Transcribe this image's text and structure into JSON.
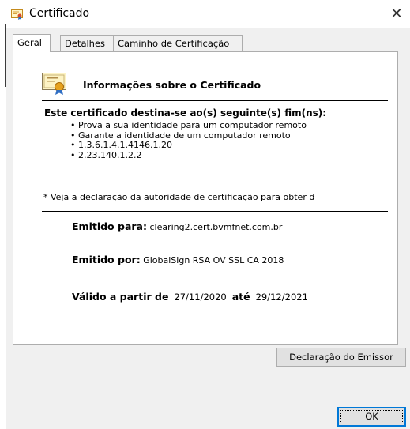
{
  "window": {
    "title": "Certificado",
    "close_glyph": "✕"
  },
  "tabs": [
    {
      "label": "Geral",
      "active": true
    },
    {
      "label": "Detalhes",
      "active": false
    },
    {
      "label": "Caminho de Certificação",
      "active": false
    }
  ],
  "general": {
    "info_title": "Informações sobre o Certificado",
    "purpose_title": "Este certificado destina-se ao(s) seguinte(s) fim(ns):",
    "purposes": [
      "Prova a sua identidade para um computador remoto",
      "Garante a identidade de um computador remoto",
      "1.3.6.1.4.1.4146.1.20",
      "2.23.140.1.2.2"
    ],
    "note": "* Veja a declaração da autoridade de certificação para obter d",
    "issued_to_label": "Emitido para:",
    "issued_to_value": "clearing2.cert.bvmfnet.com.br",
    "issued_by_label": "Emitido por:",
    "issued_by_value": "GlobalSign RSA OV SSL CA 2018",
    "valid_from_label": "Válido a partir de",
    "valid_from_value": "27/11/2020",
    "valid_to_label": "até",
    "valid_to_value": "29/12/2021"
  },
  "buttons": {
    "issuer_statement": "Declaração do Emissor",
    "ok": "OK"
  },
  "icons": {
    "window": "certificate-icon",
    "info": "certificate-ribbon-icon",
    "close": "close-icon"
  }
}
